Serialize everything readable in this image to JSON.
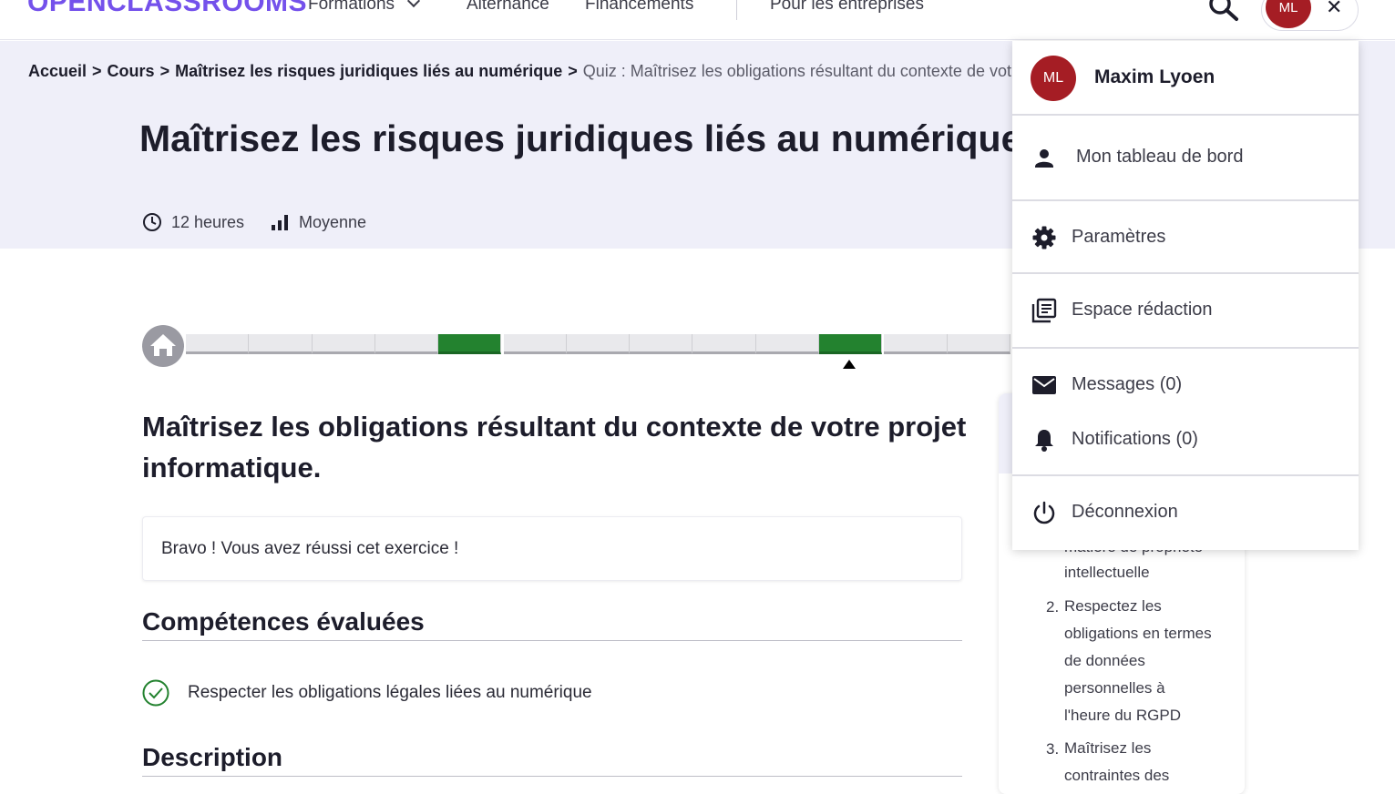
{
  "header": {
    "logo": "OPENCLASSROOMS",
    "nav": [
      "Formations",
      "Alternance",
      "Financements",
      "Pour les entreprises"
    ],
    "avatar_initials": "ML",
    "close_glyph": "✕"
  },
  "breadcrumb": {
    "items": [
      "Accueil",
      "Cours",
      "Maîtrisez les risques juridiques liés au numérique"
    ],
    "separator": ">",
    "current": "Quiz : Maîtrisez les obligations résultant du contexte de votre projet informatique."
  },
  "course": {
    "title": "Maîtrisez les risques juridiques liés au numérique",
    "duration": "12 heures",
    "level": "Moyenne"
  },
  "progress": {
    "completed_segments": [
      4,
      10
    ],
    "total_visible_segments": 13,
    "current_segment": 10
  },
  "quiz": {
    "title": "Maîtrisez les obligations résultant du contexte de votre projet informatique.",
    "success_message": "Bravo ! Vous avez réussi cet exercice !",
    "skills_heading": "Compétences évaluées",
    "skills": [
      "Respecter les obligations légales liées au numérique"
    ],
    "description_heading": "Description"
  },
  "toc": {
    "partial_lines": [
      "matière de propriété",
      "intellectuelle"
    ],
    "items": [
      {
        "num": "2.",
        "lines": [
          "Respectez les",
          "obligations en termes",
          "de données",
          "personnelles à",
          "l'heure du RGPD"
        ]
      },
      {
        "num": "3.",
        "lines": [
          "Maîtrisez les",
          "contraintes des"
        ]
      }
    ]
  },
  "user_menu": {
    "avatar_initials": "ML",
    "name": "Maxim Lyoen",
    "items": [
      {
        "label": "Mon tableau de bord",
        "icon": "person-icon"
      },
      {
        "label": "Paramètres",
        "icon": "gear-icon"
      },
      {
        "label": "Espace rédaction",
        "icon": "library-icon"
      },
      {
        "label": "Messages (0)",
        "icon": "mail-icon"
      },
      {
        "label": "Notifications (0)",
        "icon": "bell-icon"
      },
      {
        "label": "Déconnexion",
        "icon": "power-icon"
      }
    ]
  },
  "colors": {
    "brand": "#7451eb",
    "avatar": "#a51d24",
    "progress_done": "#23822f",
    "hero_bg": "#efeff9"
  }
}
